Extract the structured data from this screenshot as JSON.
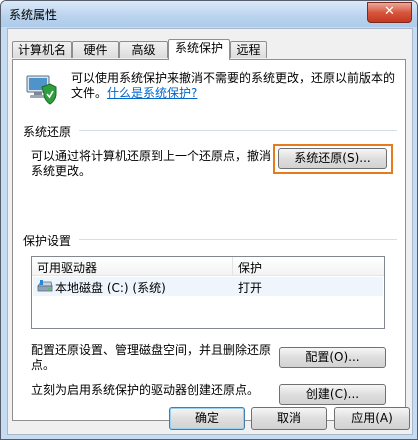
{
  "window": {
    "title": "系统属性",
    "close_glyph": "✕"
  },
  "tabs": [
    {
      "label": "计算机名",
      "active": false
    },
    {
      "label": "硬件",
      "active": false
    },
    {
      "label": "高级",
      "active": false
    },
    {
      "label": "系统保护",
      "active": true
    },
    {
      "label": "远程",
      "active": false
    }
  ],
  "intro": {
    "text": "可以使用系统保护来撤消不需要的系统更改，还原以前版本的文件。",
    "link": "什么是系统保护?"
  },
  "restore_group": {
    "label": "系统还原",
    "description": "可以通过将计算机还原到上一个还原点，撤消系统更改。",
    "button": "系统还原(S)..."
  },
  "protection_group": {
    "label": "保护设置",
    "columns": [
      "可用驱动器",
      "保护"
    ],
    "rows": [
      {
        "drive": "本地磁盘 (C:) (系统)",
        "protection": "打开"
      }
    ],
    "configure_text": "配置还原设置、管理磁盘空间，并且删除还原点。",
    "configure_button": "配置(O)...",
    "create_text": "立刻为启用系统保护的驱动器创建还原点。",
    "create_button": "创建(C)..."
  },
  "footer": {
    "ok": "确定",
    "cancel": "取消",
    "apply": "应用(A)"
  },
  "icons": {
    "shield": "computer-shield-icon",
    "disk": "hard-disk-icon"
  },
  "colors": {
    "highlight": "#e87a1e",
    "link": "#0066cc",
    "close": "#d7563d"
  }
}
